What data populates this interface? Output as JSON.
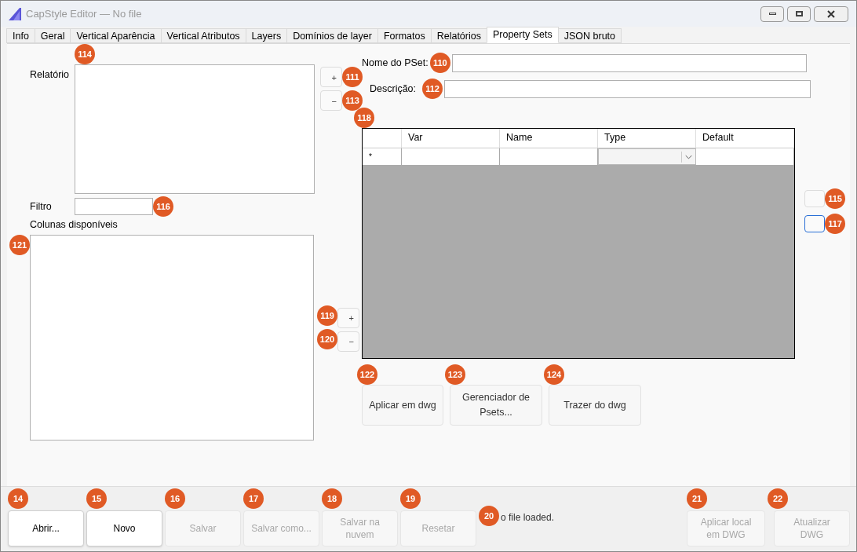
{
  "window": {
    "title": "CapStyle Editor — No file"
  },
  "tabs": [
    {
      "label": "Info",
      "selected": false
    },
    {
      "label": "Geral",
      "selected": false
    },
    {
      "label": "Vertical Aparência",
      "selected": false
    },
    {
      "label": "Vertical Atributos",
      "selected": false
    },
    {
      "label": "Layers",
      "selected": false
    },
    {
      "label": "Domínios de layer",
      "selected": false
    },
    {
      "label": "Formatos",
      "selected": false
    },
    {
      "label": "Relatórios",
      "selected": false
    },
    {
      "label": "Property Sets",
      "selected": true
    },
    {
      "label": "JSON bruto",
      "selected": false
    }
  ],
  "report": {
    "label": "Relatório",
    "badge": "114"
  },
  "report_buttons": [
    {
      "label": "+",
      "badge": "111"
    },
    {
      "label": "−",
      "badge": "113"
    }
  ],
  "filter": {
    "label": "Filtro",
    "badge": "116"
  },
  "columns": {
    "label": "Colunas disponíveis",
    "badge": "121"
  },
  "column_buttons": [
    {
      "label": "+",
      "badge": "119"
    },
    {
      "label": "−",
      "badge": "120"
    }
  ],
  "pset_name": {
    "label": "Nome do PSet:",
    "badge": "110"
  },
  "description": {
    "label": "Descrição:",
    "badge": "112"
  },
  "grid": {
    "badge": "118",
    "columns": [
      "Var",
      "Name",
      "Type",
      "Default"
    ],
    "new_row_marker": "*"
  },
  "grid_buttons": [
    {
      "badge": "115",
      "focused": false
    },
    {
      "badge": "117",
      "focused": true
    }
  ],
  "actions": [
    {
      "label": "Aplicar em dwg",
      "badge": "122"
    },
    {
      "label": "Gerenciador de Psets...",
      "badge": "123"
    },
    {
      "label": "Trazer do dwg",
      "badge": "124"
    }
  ],
  "footer": {
    "buttons": [
      {
        "label": "Abrir...",
        "badge": "14",
        "disabled": false
      },
      {
        "label": "Novo",
        "badge": "15",
        "disabled": false
      },
      {
        "label": "Salvar",
        "badge": "16",
        "disabled": true
      },
      {
        "label": "Salvar como...",
        "badge": "17",
        "disabled": true
      },
      {
        "label": "Salvar na nuvem",
        "badge": "18",
        "disabled": true
      },
      {
        "label": "Resetar",
        "badge": "19",
        "disabled": true
      }
    ],
    "status": {
      "text": "o file loaded.",
      "badge": "20"
    },
    "right_buttons": [
      {
        "label": "Aplicar local em DWG",
        "badge": "21",
        "disabled": true
      },
      {
        "label": "Atualizar DWG",
        "badge": "22",
        "disabled": true
      }
    ]
  }
}
